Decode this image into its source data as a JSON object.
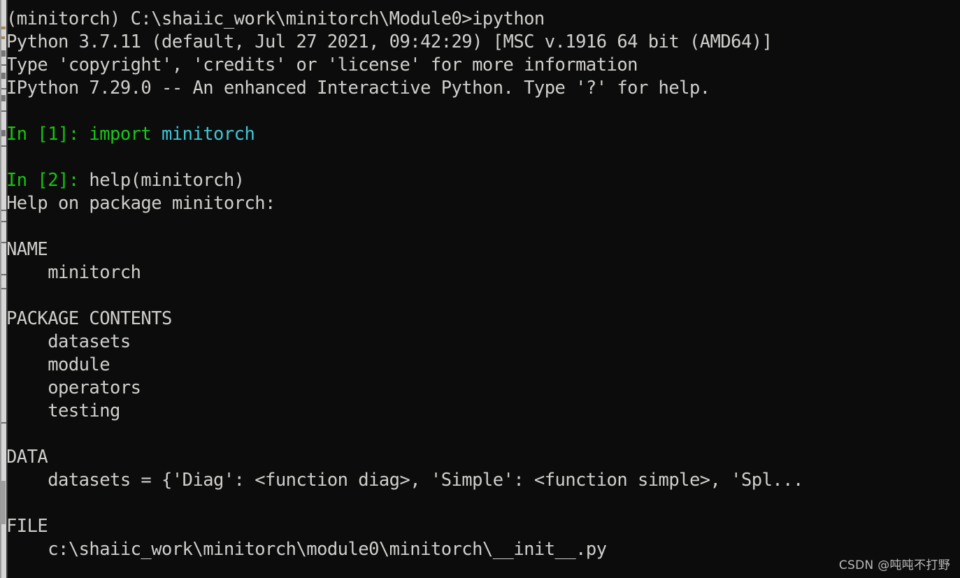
{
  "window": {
    "type": "windows-console",
    "title": "ipython",
    "background_color": "#0c0c0c",
    "foreground_color": "#cccccc"
  },
  "background_window": {
    "description": "sliver-of-window-behind",
    "strip_color": "#d6d6d6",
    "edge_color": "#9a9a9a",
    "scrollbar_thumb_color": "#9e9e9e"
  },
  "colors": {
    "prompt_green": "#16c60c",
    "keyword_green": "#19c719",
    "identifier_cyan": "#3fc7d6",
    "default_text": "#d0cfcc"
  },
  "console": {
    "lines": [
      {
        "id": "line-shell-prompt",
        "spans": [
          {
            "text": "(minitorch) C:\\shaiic_work\\minitorch\\Module0>ipython",
            "cls": "c-default"
          }
        ]
      },
      {
        "id": "line-python-version",
        "spans": [
          {
            "text": "Python 3.7.11 (default, Jul 27 2021, 09:42:29) [MSC v.1916 64 bit (AMD64)]",
            "cls": "c-default"
          }
        ]
      },
      {
        "id": "line-copyright-hint",
        "spans": [
          {
            "text": "Type 'copyright', 'credits' or 'license' for more information",
            "cls": "c-default"
          }
        ]
      },
      {
        "id": "line-ipython-banner",
        "spans": [
          {
            "text": "IPython 7.29.0 -- An enhanced Interactive Python. Type '?' for help.",
            "cls": "c-default"
          }
        ]
      },
      {
        "id": "line-blank-1",
        "spans": []
      },
      {
        "id": "line-in-1",
        "spans": [
          {
            "text": "In [1]: ",
            "cls": "c-prompt"
          },
          {
            "text": "import ",
            "cls": "c-kw"
          },
          {
            "text": "minitorch",
            "cls": "c-name"
          }
        ]
      },
      {
        "id": "line-blank-2",
        "spans": []
      },
      {
        "id": "line-in-2",
        "spans": [
          {
            "text": "In [2]: ",
            "cls": "c-prompt"
          },
          {
            "text": "help(minitorch)",
            "cls": "c-default"
          }
        ]
      },
      {
        "id": "line-help-header",
        "spans": [
          {
            "text": "Help on package minitorch:",
            "cls": "c-default"
          }
        ]
      },
      {
        "id": "line-blank-3",
        "spans": []
      },
      {
        "id": "line-section-name",
        "spans": [
          {
            "text": "NAME",
            "cls": "c-default"
          }
        ]
      },
      {
        "id": "line-name-value",
        "spans": [
          {
            "text": "    minitorch",
            "cls": "c-default"
          }
        ]
      },
      {
        "id": "line-blank-4",
        "spans": []
      },
      {
        "id": "line-section-package-contents",
        "spans": [
          {
            "text": "PACKAGE CONTENTS",
            "cls": "c-default"
          }
        ]
      },
      {
        "id": "line-pkg-datasets",
        "spans": [
          {
            "text": "    datasets",
            "cls": "c-default"
          }
        ]
      },
      {
        "id": "line-pkg-module",
        "spans": [
          {
            "text": "    module",
            "cls": "c-default"
          }
        ]
      },
      {
        "id": "line-pkg-operators",
        "spans": [
          {
            "text": "    operators",
            "cls": "c-default"
          }
        ]
      },
      {
        "id": "line-pkg-testing",
        "spans": [
          {
            "text": "    testing",
            "cls": "c-default"
          }
        ]
      },
      {
        "id": "line-blank-5",
        "spans": []
      },
      {
        "id": "line-section-data",
        "spans": [
          {
            "text": "DATA",
            "cls": "c-default"
          }
        ]
      },
      {
        "id": "line-data-datasets",
        "spans": [
          {
            "text": "    datasets = {'Diag': <function diag>, 'Simple': <function simple>, 'Spl...",
            "cls": "c-default"
          }
        ]
      },
      {
        "id": "line-blank-6",
        "spans": []
      },
      {
        "id": "line-section-file",
        "spans": [
          {
            "text": "FILE",
            "cls": "c-default"
          }
        ]
      },
      {
        "id": "line-file-path",
        "spans": [
          {
            "text": "    c:\\shaiic_work\\minitorch\\module0\\minitorch\\__init__.py",
            "cls": "c-default"
          }
        ]
      }
    ]
  },
  "watermark": {
    "text": "CSDN @吨吨不打野"
  }
}
